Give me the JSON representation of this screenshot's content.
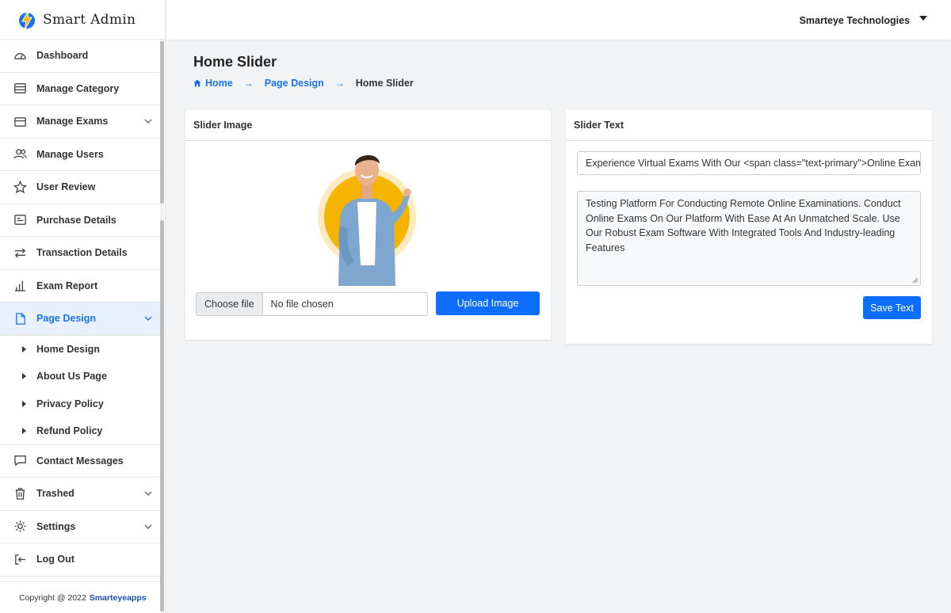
{
  "brand": {
    "name": "Smart Admin",
    "logo_icon": "lightning-bolt-icon",
    "accent": "#1a73e8"
  },
  "topbar": {
    "company": "Smarteye Technologies"
  },
  "sidebar": {
    "items": [
      {
        "label": "Dashboard",
        "icon": "speedometer-icon"
      },
      {
        "label": "Manage Category",
        "icon": "category-icon"
      },
      {
        "label": "Manage Exams",
        "icon": "folder-icon",
        "has_submenu": true
      },
      {
        "label": "Manage Users",
        "icon": "users-icon"
      },
      {
        "label": "User Review",
        "icon": "star-icon"
      },
      {
        "label": "Purchase Details",
        "icon": "receipt-icon"
      },
      {
        "label": "Transaction Details",
        "icon": "transfer-arrows-icon"
      },
      {
        "label": "Exam Report",
        "icon": "bar-chart-icon"
      },
      {
        "label": "Page Design",
        "icon": "page-icon",
        "has_submenu": true,
        "active": true
      }
    ],
    "submenu": [
      {
        "label": "Home Design"
      },
      {
        "label": "About Us Page"
      },
      {
        "label": "Privacy Policy"
      },
      {
        "label": "Refund Policy"
      }
    ],
    "items_after": [
      {
        "label": "Contact Messages",
        "icon": "chat-icon"
      },
      {
        "label": "Trashed",
        "icon": "trash-icon",
        "has_submenu": true
      },
      {
        "label": "Settings",
        "icon": "gear-icon",
        "has_submenu": true
      },
      {
        "label": "Log Out",
        "icon": "logout-icon"
      }
    ],
    "footer": {
      "text": "Copyright @ 2022",
      "link": "Smarteyeapps"
    }
  },
  "main": {
    "title": "Home Slider",
    "breadcrumb": [
      "Home",
      "Page Design",
      "Home Slider"
    ],
    "slider_image": {
      "header": "Slider Image",
      "choose_label": "Choose file",
      "file_status": "No file chosen",
      "upload_label": "Upload Image"
    },
    "slider_text": {
      "header": "Slider Text",
      "heading_value": "Experience Virtual Exams With Our <span class=\"text-primary\">Online Exam",
      "body_value": "Testing Platform For Conducting Remote Online Examinations. Conduct Online Exams On Our Platform With Ease At An Unmatched Scale. Use Our Robust Exam Software With Integrated Tools And Industry-leading Features",
      "save_label": "Save Text"
    }
  }
}
